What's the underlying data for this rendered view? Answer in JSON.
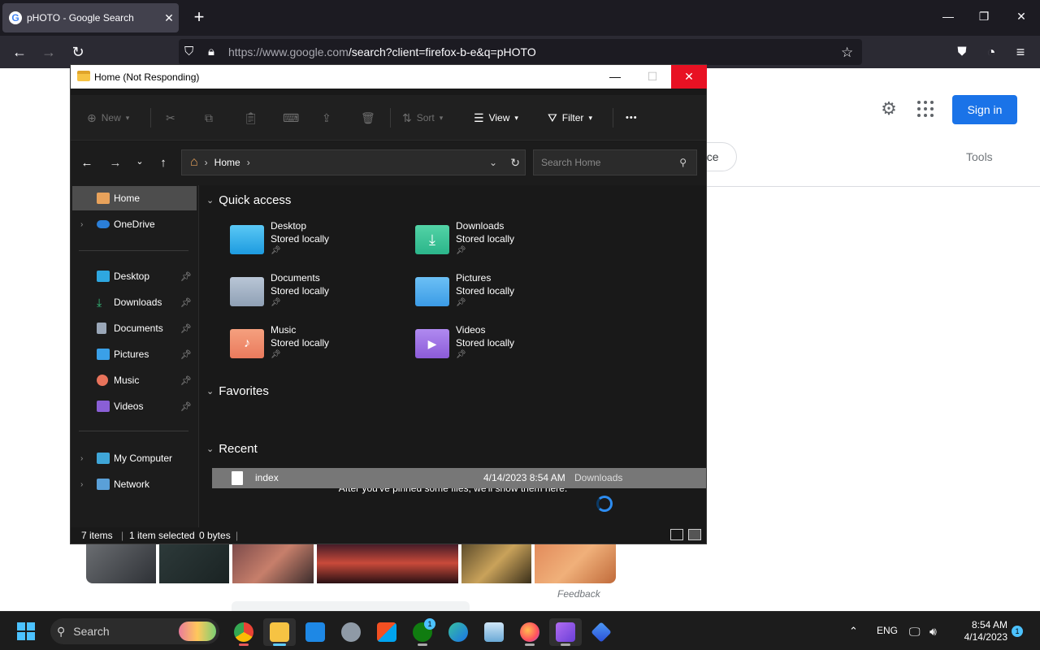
{
  "browser": {
    "tab_title": "pHOTO - Google Search",
    "tab_close": "✕",
    "new_tab": "+",
    "url_host": "https://www.google.com",
    "url_rest": "/search?client=firefox-b-e&q=pHOTO",
    "window_controls": {
      "minimize": "—",
      "restore": "❐",
      "close": "✕"
    }
  },
  "google": {
    "sign_in": "Sign in",
    "chip_partial": "nce",
    "tools": "Tools",
    "feedback": "Feedback"
  },
  "explorer": {
    "title": "Home (Not Responding)",
    "title_buttons": {
      "minimize": "—",
      "maximize": "☐",
      "close": "✕"
    },
    "toolbar": {
      "new": "New",
      "sort": "Sort",
      "view": "View",
      "filter": "Filter",
      "more": "•••"
    },
    "address": {
      "segment": "Home"
    },
    "search_placeholder": "Search Home",
    "sidebar": {
      "home": "Home",
      "onedrive": "OneDrive",
      "pinned": [
        {
          "label": "Desktop",
          "color": "#2ea7e0"
        },
        {
          "label": "Downloads",
          "color": "#35c07d"
        },
        {
          "label": "Documents",
          "color": "#9aa7b8"
        },
        {
          "label": "Pictures",
          "color": "#3aa0e8"
        },
        {
          "label": "Music",
          "color": "#e8735b"
        },
        {
          "label": "Videos",
          "color": "#8a5fd6"
        }
      ],
      "my_computer": "My Computer",
      "network": "Network"
    },
    "quick_access": {
      "header": "Quick access",
      "items": [
        {
          "name": "Desktop",
          "status": "Stored locally",
          "color": "#1d9be0"
        },
        {
          "name": "Downloads",
          "status": "Stored locally",
          "color": "#2bb58a"
        },
        {
          "name": "Documents",
          "status": "Stored locally",
          "color": "#8fa0b5"
        },
        {
          "name": "Pictures",
          "status": "Stored locally",
          "color": "#3b9be6"
        },
        {
          "name": "Music",
          "status": "Stored locally",
          "color": "#ea7a5d"
        },
        {
          "name": "Videos",
          "status": "Stored locally",
          "color": "#8c5bd8"
        }
      ]
    },
    "favorites": {
      "header": "Favorites",
      "empty_message": "After you've pinned some files, we'll show them here."
    },
    "recent": {
      "header": "Recent",
      "items": [
        {
          "name": "index",
          "date": "4/14/2023 8:54 AM",
          "location": "Downloads"
        }
      ]
    },
    "status": {
      "items": "7 items",
      "selected": "1 item selected",
      "size": "0 bytes"
    }
  },
  "taskbar": {
    "search_label": "Search",
    "tray_lang": "ENG",
    "time": "8:54 AM",
    "date": "4/14/2023",
    "notification_count": "1",
    "xbox_badge": "1"
  }
}
